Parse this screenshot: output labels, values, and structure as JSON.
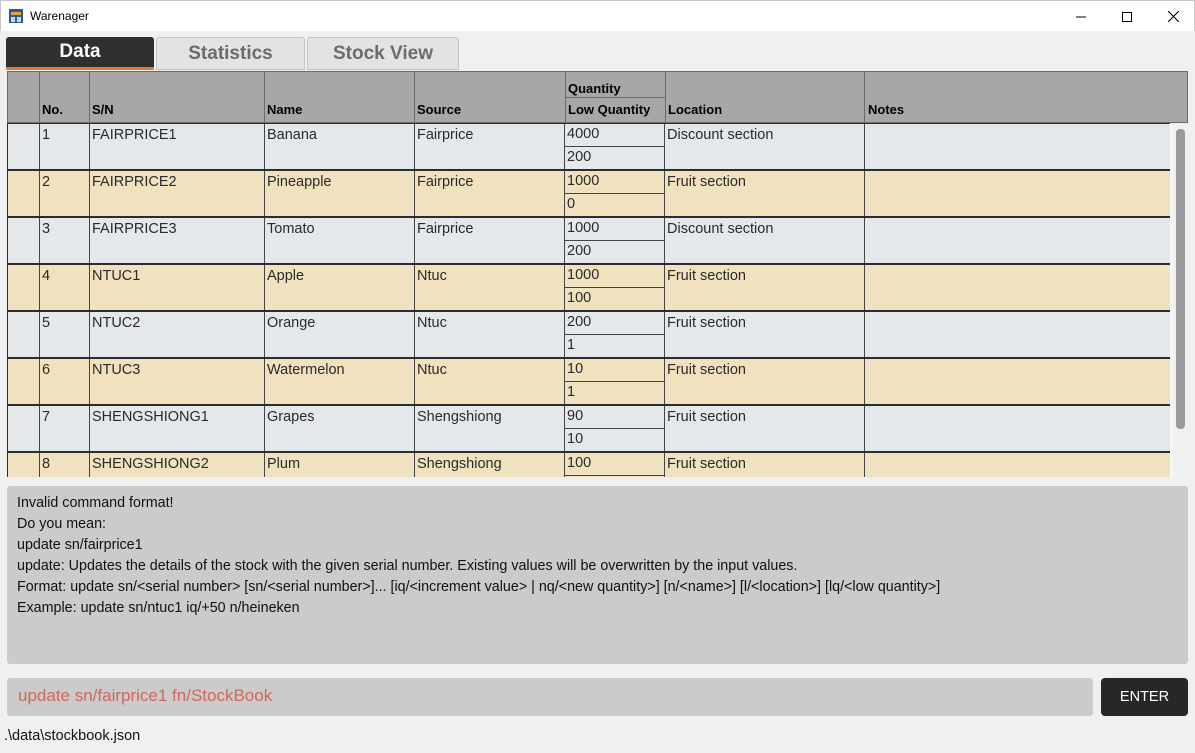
{
  "window": {
    "title": "Warenager"
  },
  "tabs": [
    {
      "label": "Data",
      "selected": true
    },
    {
      "label": "Statistics",
      "selected": false
    },
    {
      "label": "Stock View",
      "selected": false
    }
  ],
  "table": {
    "headers": {
      "no": "No.",
      "sn": "S/N",
      "name": "Name",
      "source": "Source",
      "quantity": "Quantity",
      "low_quantity": "Low Quantity",
      "location": "Location",
      "notes": "Notes"
    },
    "rows": [
      {
        "no": "1",
        "sn": "FAIRPRICE1",
        "name": "Banana",
        "source": "Fairprice",
        "quantity": "4000",
        "low_quantity": "200",
        "location": "Discount section",
        "notes": ""
      },
      {
        "no": "2",
        "sn": "FAIRPRICE2",
        "name": "Pineapple",
        "source": "Fairprice",
        "quantity": "1000",
        "low_quantity": "0",
        "location": "Fruit section",
        "notes": ""
      },
      {
        "no": "3",
        "sn": "FAIRPRICE3",
        "name": "Tomato",
        "source": "Fairprice",
        "quantity": "1000",
        "low_quantity": "200",
        "location": "Discount section",
        "notes": ""
      },
      {
        "no": "4",
        "sn": "NTUC1",
        "name": "Apple",
        "source": "Ntuc",
        "quantity": "1000",
        "low_quantity": "100",
        "location": "Fruit section",
        "notes": ""
      },
      {
        "no": "5",
        "sn": "NTUC2",
        "name": "Orange",
        "source": "Ntuc",
        "quantity": "200",
        "low_quantity": "1",
        "location": "Fruit section",
        "notes": ""
      },
      {
        "no": "6",
        "sn": "NTUC3",
        "name": "Watermelon",
        "source": "Ntuc",
        "quantity": "10",
        "low_quantity": "1",
        "location": "Fruit section",
        "notes": ""
      },
      {
        "no": "7",
        "sn": "SHENGSHIONG1",
        "name": "Grapes",
        "source": "Shengshiong",
        "quantity": "90",
        "low_quantity": "10",
        "location": "Fruit section",
        "notes": ""
      },
      {
        "no": "8",
        "sn": "SHENGSHIONG2",
        "name": "Plum",
        "source": "Shengshiong",
        "quantity": "100",
        "low_quantity": "",
        "location": "Fruit section",
        "notes": ""
      }
    ]
  },
  "result": {
    "lines": [
      "Invalid command format!",
      "Do you mean:",
      "update sn/fairprice1",
      "update: Updates the details of the stock with the given serial number. Existing values will be overwritten by the input values.",
      "Format: update sn/<serial number> [sn/<serial number>]... [iq/<increment value> | nq/<new quantity>] [n/<name>] [l/<location>] [lq/<low quantity>]",
      "Example: update sn/ntuc1 iq/+50 n/heineken"
    ]
  },
  "command": {
    "value": "update sn/fairprice1 fn/StockBook",
    "enter_label": "ENTER"
  },
  "status": {
    "file_path": ".\\data\\stockbook.json"
  },
  "colors": {
    "row_odd": "#e4e8ea",
    "row_even": "#f0e2be",
    "tab_active": "#2f2f2f",
    "tab_accent": "#e07a35",
    "command_text": "#d0685c"
  }
}
